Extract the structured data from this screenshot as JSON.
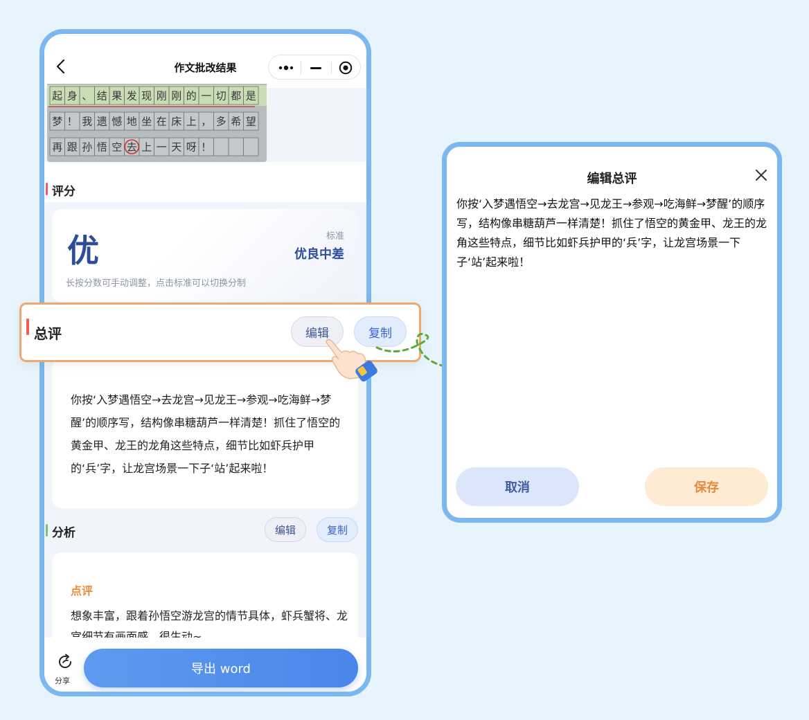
{
  "app": {
    "title": "作文批改结果"
  },
  "essay_image": {
    "rows": [
      [
        "起",
        "身",
        "、",
        "结",
        "果",
        "发",
        "现",
        "刚",
        "刚",
        "的",
        "一",
        "切",
        "都",
        "是"
      ],
      [
        "梦",
        "！",
        "我",
        "遗",
        "憾",
        "地",
        "坐",
        "在",
        "床",
        "上",
        "，",
        "多",
        "希",
        "望"
      ],
      [
        "再",
        "跟",
        "孙",
        "悟",
        "空",
        "去",
        "上",
        "一",
        "天",
        "呀",
        "！",
        "",
        "",
        ""
      ]
    ]
  },
  "score": {
    "section_title": "评分",
    "grade": "优",
    "standard_label": "标准",
    "standard_value": "优良中差",
    "hint": "长按分数可手动调整，点击标准可以切换分制"
  },
  "summary": {
    "section_title": "总评",
    "edit_label": "编辑",
    "copy_label": "复制",
    "text": "你按‘入梦遇悟空→去龙宫→见龙王→参观→吃海鲜→梦醒’的顺序写，结构像串糖葫芦一样清楚！抓住了悟空的黄金甲、龙王的龙角这些特点，细节比如虾兵护甲的‘兵’字，让龙宫场景一下子‘站’起来啦！"
  },
  "analysis": {
    "section_title": "分析",
    "edit_label": "编辑",
    "copy_label": "复制",
    "subtitle": "点评",
    "text": "想象丰富，跟着孙悟空游龙宫的情节具体，虾兵蟹将、龙宫细节有画面感，很生动~"
  },
  "bottom": {
    "share_label": "分享",
    "export_label": "导出 word"
  },
  "dialog": {
    "title": "编辑总评",
    "text": "你按‘入梦遇悟空→去龙宫→见龙王→参观→吃海鲜→梦醒’的顺序写，结构像串糖葫芦一样清楚！抓住了悟空的黄金甲、龙王的龙角这些特点，细节比如虾兵护甲的‘兵’字，让龙宫场景一下子‘站’起来啦！",
    "cancel_label": "取消",
    "save_label": "保存"
  },
  "colors": {
    "frame_border": "#7cb8f0",
    "accent_blue": "#2d4d9b",
    "highlight_border": "#f0a870",
    "save_orange": "#e28b3d",
    "arrow_green": "#5aab3a",
    "score_bar": "#f05a5a",
    "analysis_bar": "#7ac76a"
  },
  "icons": {
    "back": "chevron-left-icon",
    "more": "more-dots-icon",
    "minimize": "minus-icon",
    "target": "target-icon",
    "close": "close-icon",
    "share": "share-icon",
    "hand": "hand-pointer-icon"
  }
}
